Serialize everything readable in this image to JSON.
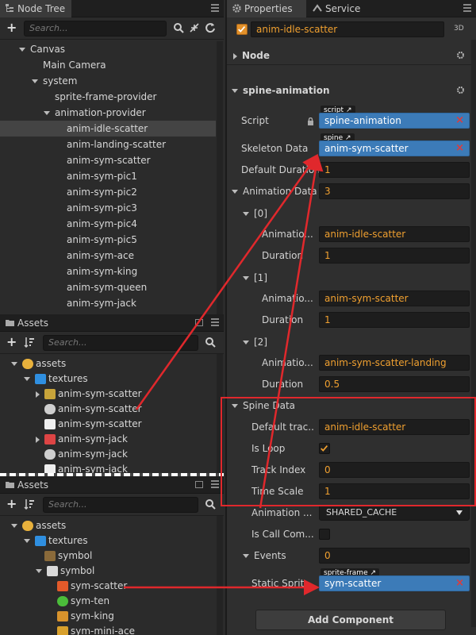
{
  "node_tree": {
    "tab_label": "Node Tree",
    "search_placeholder": "Search...",
    "items": [
      {
        "label": "Canvas"
      },
      {
        "label": "Main Camera"
      },
      {
        "label": "system"
      },
      {
        "label": "sprite-frame-provider"
      },
      {
        "label": "animation-provider"
      },
      {
        "label": "anim-idle-scatter"
      },
      {
        "label": "anim-landing-scatter"
      },
      {
        "label": "anim-sym-scatter"
      },
      {
        "label": "anim-sym-pic1"
      },
      {
        "label": "anim-sym-pic2"
      },
      {
        "label": "anim-sym-pic3"
      },
      {
        "label": "anim-sym-pic4"
      },
      {
        "label": "anim-sym-pic5"
      },
      {
        "label": "anim-sym-ace"
      },
      {
        "label": "anim-sym-king"
      },
      {
        "label": "anim-sym-queen"
      },
      {
        "label": "anim-sym-jack"
      }
    ]
  },
  "assets_top": {
    "tab_label": "Assets",
    "search_placeholder": "Search...",
    "items": [
      {
        "label": "assets"
      },
      {
        "label": "textures"
      },
      {
        "label": "anim-sym-scatter"
      },
      {
        "label": "anim-sym-scatter"
      },
      {
        "label": "anim-sym-scatter"
      },
      {
        "label": "anim-sym-jack"
      },
      {
        "label": "anim-sym-jack"
      },
      {
        "label": "anim-sym-jack"
      }
    ]
  },
  "assets_bottom": {
    "tab_label": "Assets",
    "search_placeholder": "Search...",
    "items": [
      {
        "label": "assets"
      },
      {
        "label": "textures"
      },
      {
        "label": "symbol"
      },
      {
        "label": "symbol"
      },
      {
        "label": "sym-scatter"
      },
      {
        "label": "sym-ten"
      },
      {
        "label": "sym-king"
      },
      {
        "label": "sym-mini-ace"
      }
    ]
  },
  "properties": {
    "tab_label": "Properties",
    "service_tab_label": "Service",
    "node_name": "anim-idle-scatter",
    "badge_3d": "3D",
    "node_section": "Node",
    "component_title": "spine-animation",
    "script_label": "Script",
    "script_tag": "script",
    "script_value": "spine-animation",
    "skeleton_label": "Skeleton Data",
    "skeleton_tag": "spine",
    "skeleton_value": "anim-sym-scatter",
    "default_duration_label": "Default Duration",
    "default_duration_value": "1",
    "animation_data_label": "Animation Data",
    "animation_data_value": "3",
    "entries": [
      {
        "index": "[0]",
        "anim_label": "Animatio...",
        "anim_value": "anim-idle-scatter",
        "duration_label": "Duration",
        "duration_value": "1"
      },
      {
        "index": "[1]",
        "anim_label": "Animatio...",
        "anim_value": "anim-sym-scatter",
        "duration_label": "Duration",
        "duration_value": "1"
      },
      {
        "index": "[2]",
        "anim_label": "Animatio...",
        "anim_value": "anim-sym-scatter-landing",
        "duration_label": "Duration",
        "duration_value": "0.5"
      }
    ],
    "spine_data": {
      "title": "Spine Data",
      "default_track_label": "Default trac...",
      "default_track_value": "anim-idle-scatter",
      "is_loop_label": "Is Loop",
      "track_index_label": "Track Index",
      "track_index_value": "0",
      "time_scale_label": "Time Scale",
      "time_scale_value": "1"
    },
    "animation_cache_label": "Animation ...",
    "animation_cache_value": "SHARED_CACHE",
    "is_call_label": "Is Call Com...",
    "events_label": "Events",
    "events_value": "0",
    "static_sprite_label": "Static Sprit",
    "static_sprite_tag": "sprite-frame",
    "static_sprite_value": "sym-scatter",
    "add_component_label": "Add Component"
  },
  "colors": {
    "accent_orange": "#f0a030",
    "asset_blue": "#3c7bb8",
    "annotation_red": "#e0282c"
  }
}
